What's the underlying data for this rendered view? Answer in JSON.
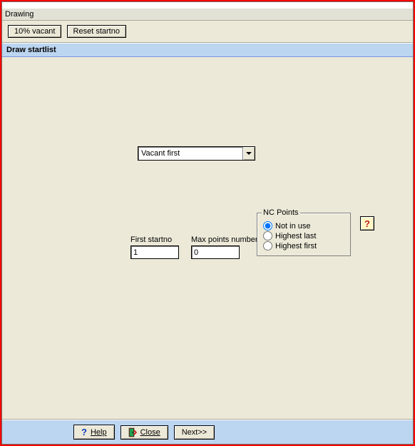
{
  "title_sliver": "",
  "menu": {
    "drawing": "Drawing"
  },
  "toolbar": {
    "vacant_btn": "10% vacant",
    "reset_btn": "Reset startno"
  },
  "section": {
    "header": "Draw startlist"
  },
  "dropdown": {
    "selected": "Vacant first"
  },
  "first_startno": {
    "label": "First startno",
    "value": "1"
  },
  "max_points": {
    "label": "Max points number",
    "value": "0"
  },
  "nc_points": {
    "legend": "NC Points",
    "opt_not_in_use": "Not in use",
    "opt_highest_last": "Highest last",
    "opt_highest_first": "Highest first"
  },
  "help_small": "?",
  "footer": {
    "help": "Help",
    "help_icon": "?",
    "close": "Close",
    "next": "Next>>"
  }
}
